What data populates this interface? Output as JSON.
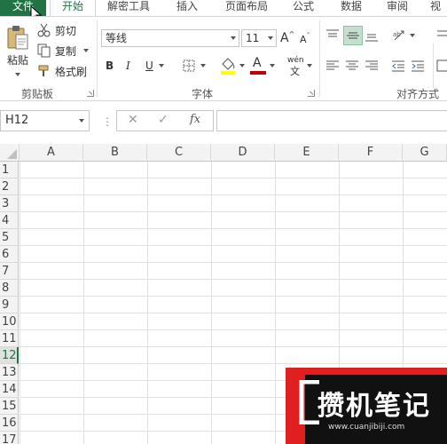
{
  "tabs": [
    {
      "label": "文件"
    },
    {
      "label": "开始"
    },
    {
      "label": "解密工具"
    },
    {
      "label": "插入"
    },
    {
      "label": "页面布局"
    },
    {
      "label": "公式"
    },
    {
      "label": "数据"
    },
    {
      "label": "审阅"
    },
    {
      "label": "视"
    }
  ],
  "clipboard": {
    "paste": "粘贴",
    "cut": "剪切",
    "copy": "复制",
    "format_painter": "格式刷",
    "group_label": "剪贴板"
  },
  "font": {
    "name": "等线",
    "size": "11",
    "bold": "B",
    "italic": "I",
    "underline": "U",
    "grow": "A",
    "shrink": "A",
    "font_color_letter": "A",
    "phonetic_top": "wén",
    "phonetic_bottom": "文",
    "group_label": "字体",
    "highlight_color": "#ffff00",
    "font_color": "#c00000"
  },
  "alignment": {
    "group_label": "对齐方式"
  },
  "formula_bar": {
    "name_box": "H12",
    "cancel": "✕",
    "enter": "✓",
    "fx": "fx"
  },
  "grid": {
    "columns": [
      "A",
      "B",
      "C",
      "D",
      "E",
      "F",
      "G"
    ],
    "rows": [
      "1",
      "2",
      "3",
      "4",
      "5",
      "6",
      "7",
      "8",
      "9",
      "10",
      "11",
      "12",
      "13",
      "14",
      "15",
      "16",
      "17"
    ],
    "selected_row": "12"
  },
  "watermark": {
    "title": "攒机笔记",
    "url": "www.cuanjibiji.com"
  },
  "colors": {
    "accent": "#217346",
    "watermark_red": "#e02020"
  }
}
